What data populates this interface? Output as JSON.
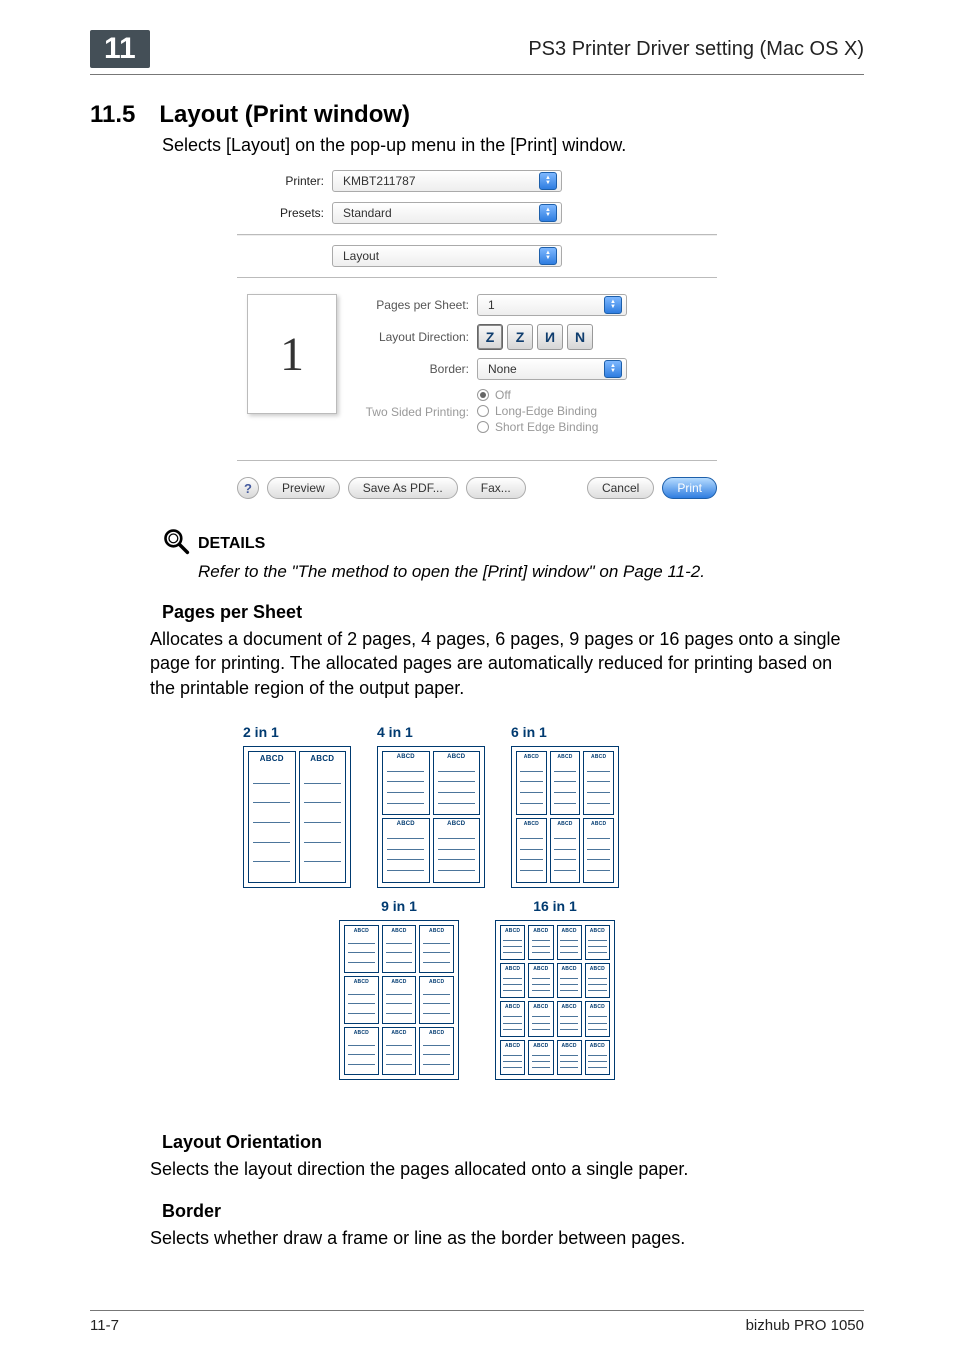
{
  "header": {
    "chapter_number": "11",
    "page_title": "PS3 Printer Driver setting (Mac OS X)"
  },
  "section": {
    "number": "11.5",
    "title": "Layout (Print window)",
    "intro": "Selects [Layout] on the pop-up menu in the [Print] window."
  },
  "dialog": {
    "printer_label": "Printer:",
    "printer_value": "KMBT211787",
    "presets_label": "Presets:",
    "presets_value": "Standard",
    "panel_value": "Layout",
    "pages_per_sheet_label": "Pages per Sheet:",
    "pages_per_sheet_value": "1",
    "layout_direction_label": "Layout Direction:",
    "border_label": "Border:",
    "border_value": "None",
    "two_sided_label": "Two Sided Printing:",
    "two_sided_options": {
      "off": "Off",
      "long": "Long-Edge Binding",
      "short": "Short Edge Binding"
    },
    "preview_number": "1",
    "buttons": {
      "help": "?",
      "preview": "Preview",
      "save_pdf": "Save As PDF...",
      "fax": "Fax...",
      "cancel": "Cancel",
      "print": "Print"
    },
    "layout_direction_icons": [
      "Z-horizontal",
      "Z-vertical",
      "Z-horizontal-mirror",
      "Z-vertical-mirror"
    ]
  },
  "details": {
    "label": "DETAILS",
    "body": "Refer to the \"The method to open the [Print] window\" on Page 11-2."
  },
  "pps": {
    "heading": "Pages per Sheet",
    "body": "Allocates a document of 2 pages, 4 pages, 6 pages, 9 pages or 16 pages onto a single page for printing. The allocated pages are automatically reduced for printing based on the printable region of the output paper.",
    "items": [
      {
        "label": "2 in 1",
        "grid": 2
      },
      {
        "label": "4 in 1",
        "grid": 4
      },
      {
        "label": "6 in 1",
        "grid": 6
      },
      {
        "label": "9 in 1",
        "grid": 9
      },
      {
        "label": "16 in 1",
        "grid": 16
      }
    ],
    "mini_label": "ABCD"
  },
  "layout_orientation": {
    "heading": "Layout Orientation",
    "body": "Selects the layout direction the pages allocated onto a single paper."
  },
  "border": {
    "heading": "Border",
    "body": "Selects whether draw a frame or line as the border between pages."
  },
  "footer": {
    "page_no": "11-7",
    "product": "bizhub PRO 1050"
  }
}
